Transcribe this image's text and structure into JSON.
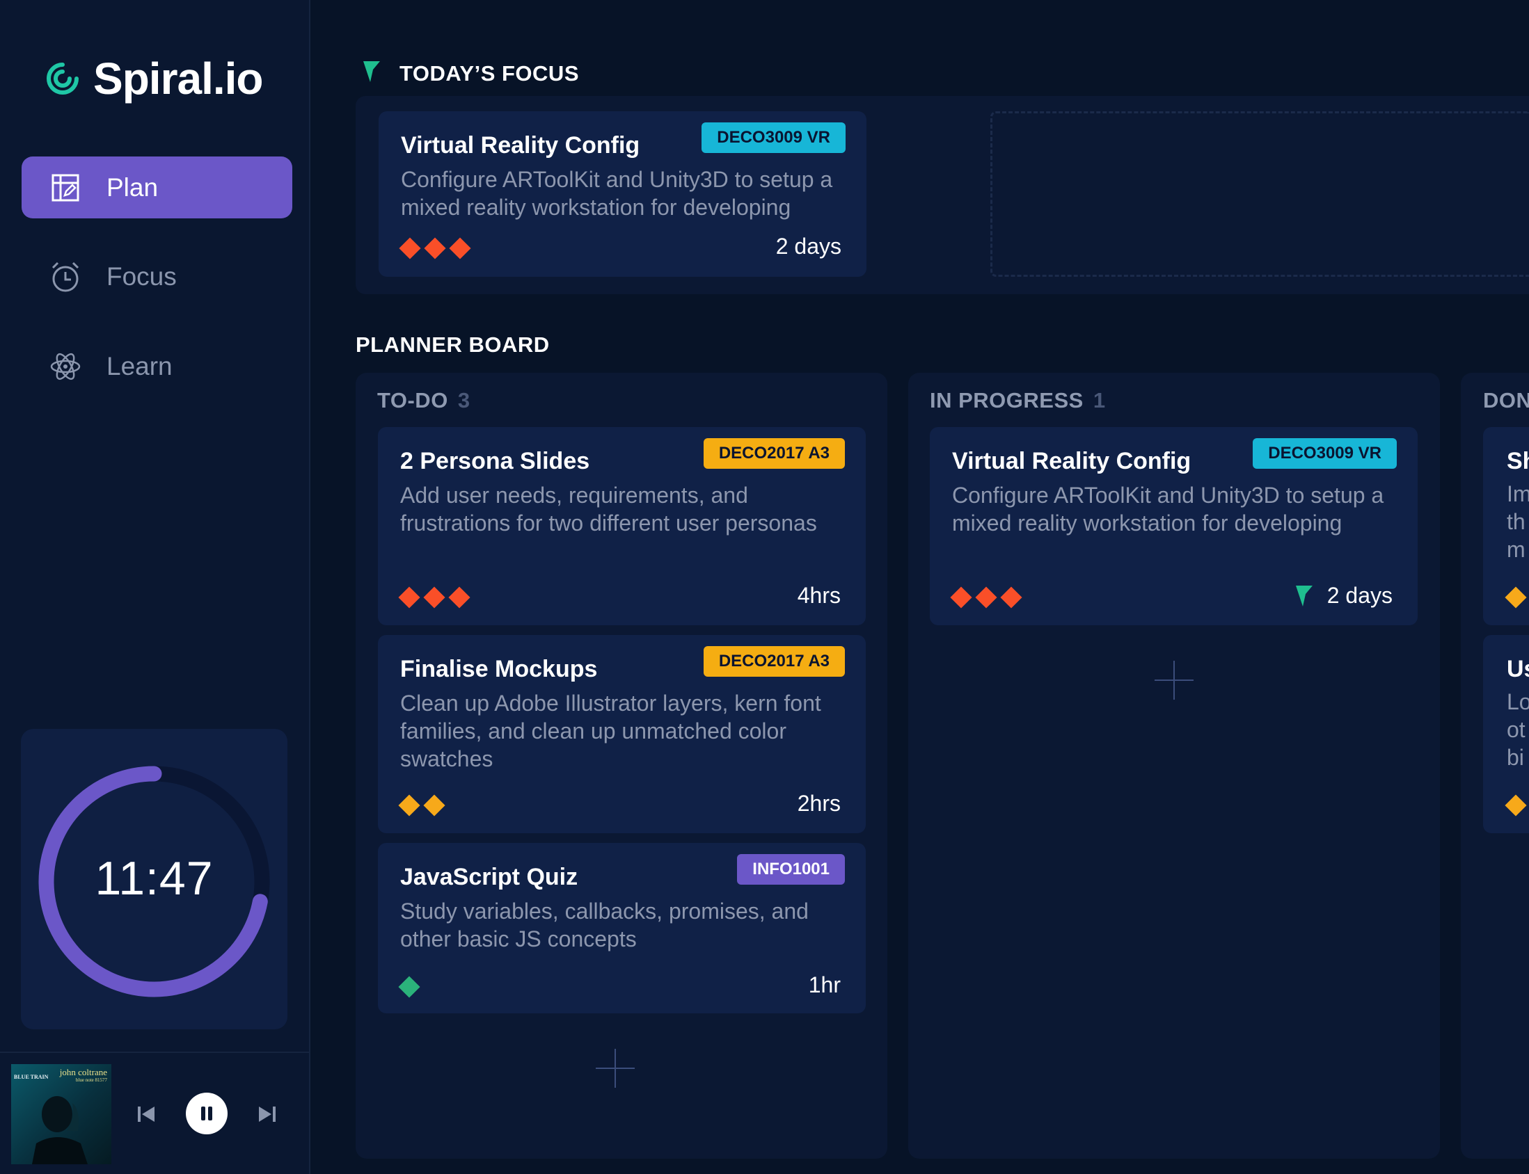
{
  "app": {
    "name": "Spiral.io",
    "brand_color": "#1fc7a6",
    "accent_color": "#6b57c8",
    "background": "#071327"
  },
  "sidebar": {
    "nav": [
      {
        "label": "Plan",
        "icon": "plan-icon",
        "active": true
      },
      {
        "label": "Focus",
        "icon": "alarm-clock-icon",
        "active": false
      },
      {
        "label": "Learn",
        "icon": "atom-icon",
        "active": false
      }
    ],
    "timer": {
      "time": "11:47",
      "progress": 0.72
    },
    "player": {
      "album_artist": "john coltrane",
      "album_label": "blue note 81577",
      "album_title": "BLUE TRAIN",
      "state": "playing"
    }
  },
  "focus": {
    "heading": "TODAY’S FOCUS",
    "card": {
      "title": "Virtual Reality Config",
      "tag": "DECO3009 VR",
      "description": "Configure ARToolKit and Unity3D to setup a mixed reality workstation for developing",
      "priority": 3,
      "priority_color": "#fa4f28",
      "duration": "2 days"
    }
  },
  "board": {
    "heading": "PLANNER BOARD",
    "columns": [
      {
        "title": "TO-DO",
        "count": "3",
        "cards": [
          {
            "title": "2 Persona Slides",
            "tag": "DECO2017 A3",
            "description": "Add user needs, requirements, and frustrations for two different user personas",
            "priority": 3,
            "priority_color": "#fa4f28",
            "duration": "4hrs"
          },
          {
            "title": "Finalise Mockups",
            "tag": "DECO2017 A3",
            "description": "Clean up Adobe Illustrator layers, kern font families, and clean up unmatched color swatches",
            "priority": 2,
            "priority_color": "#f7a91a",
            "duration": "2hrs"
          },
          {
            "title": "JavaScript Quiz",
            "tag": "INFO1001",
            "description": "Study variables, callbacks, promises, and other basic JS concepts",
            "priority": 1,
            "priority_color": "#2bb37b",
            "duration": "1hr"
          }
        ]
      },
      {
        "title": "IN PROGRESS",
        "count": "1",
        "cards": [
          {
            "title": "Virtual Reality Config",
            "tag": "DECO3009 VR",
            "description": "Configure ARToolKit and Unity3D to setup a mixed reality workstation for developing",
            "priority": 3,
            "priority_color": "#fa4f28",
            "duration": "2 days",
            "focused": true
          }
        ]
      },
      {
        "title": "DON",
        "count": "",
        "cards": [
          {
            "title": "Sh",
            "lines": [
              "Im",
              "th",
              "m"
            ],
            "priority_color": "#f7a91a"
          },
          {
            "title": "Us",
            "lines": [
              "Lo",
              "ot",
              "bi"
            ],
            "priority_color": "#f7a91a"
          }
        ]
      }
    ]
  }
}
